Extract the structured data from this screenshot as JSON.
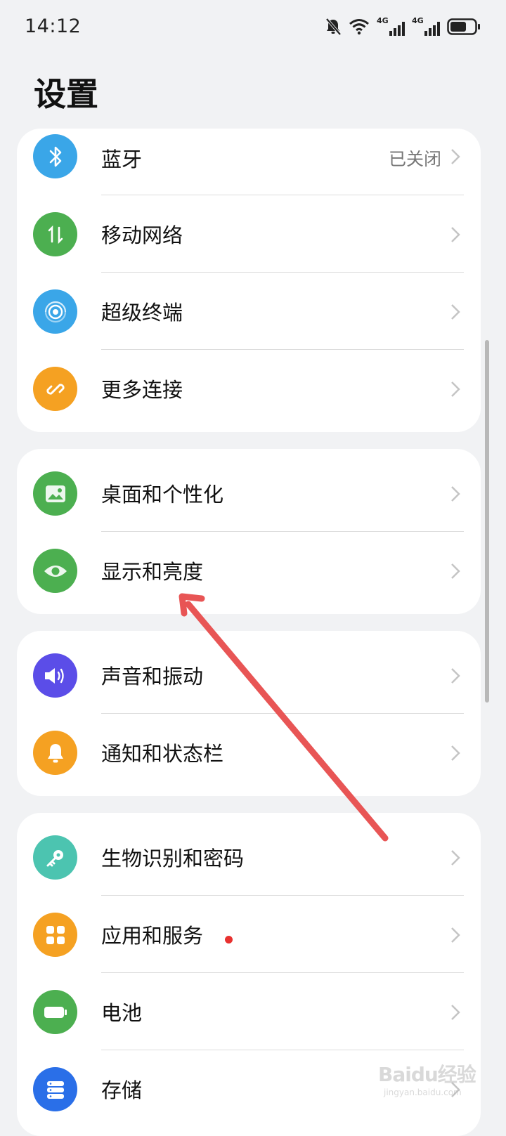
{
  "status_bar": {
    "time": "14:12",
    "net1_label": "4G",
    "net2_label": "4G",
    "icons": [
      "mute-bell-icon",
      "wifi-icon",
      "signal-4g-icon",
      "signal-4g-icon",
      "battery-icon"
    ]
  },
  "page": {
    "title": "设置"
  },
  "groups": [
    {
      "items": [
        {
          "label": "蓝牙",
          "value": "已关闭",
          "icon": "bluetooth-icon",
          "color": "#3aa6e8"
        },
        {
          "label": "移动网络",
          "icon": "mobile-data-icon",
          "color": "#4caf50"
        },
        {
          "label": "超级终端",
          "icon": "super-device-icon",
          "color": "#3aa6e8"
        },
        {
          "label": "更多连接",
          "icon": "link-icon",
          "color": "#f5a122"
        }
      ]
    },
    {
      "items": [
        {
          "label": "桌面和个性化",
          "icon": "wallpaper-icon",
          "color": "#4caf50"
        },
        {
          "label": "显示和亮度",
          "icon": "eye-icon",
          "color": "#4caf50"
        }
      ]
    },
    {
      "items": [
        {
          "label": "声音和振动",
          "icon": "speaker-icon",
          "color": "#5b4de8"
        },
        {
          "label": "通知和状态栏",
          "icon": "bell-icon",
          "color": "#f5a122"
        }
      ]
    },
    {
      "items": [
        {
          "label": "生物识别和密码",
          "icon": "key-icon",
          "color": "#4cc4b0"
        },
        {
          "label": "应用和服务",
          "icon": "apps-icon",
          "color": "#f5a122",
          "badge": "red-dot"
        },
        {
          "label": "电池",
          "icon": "battery-icon",
          "color": "#4caf50"
        },
        {
          "label": "存储",
          "icon": "storage-icon",
          "color": "#2a6fe8"
        }
      ]
    }
  ],
  "annotation": {
    "type": "red-arrow",
    "points_to": "显示和亮度",
    "color": "#e85555"
  },
  "watermark": {
    "logo": "Baidu经验",
    "url_text": "jingyan.baidu.com"
  }
}
